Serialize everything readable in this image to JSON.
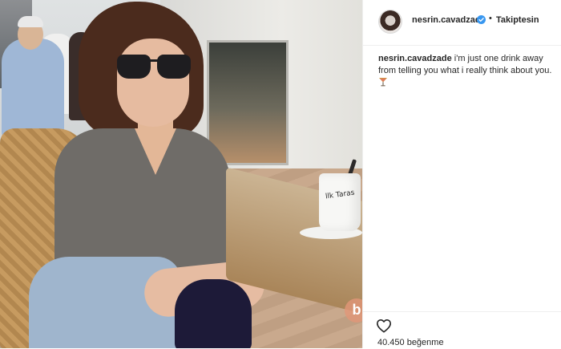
{
  "post": {
    "username": "nesrin.cavadzade",
    "follow_label": "Takiptesin",
    "caption_user": "nesrin.cavadzade",
    "caption_text": " i'm just one drink away from telling you what i really think about you.",
    "cup_text": "llk Taras",
    "watermark_letter": "b",
    "likes": "40.450 beğenme"
  },
  "icons": {
    "verified": "verified-badge-icon",
    "cocktail": "cocktail-glass-icon",
    "heart": "heart-outline-icon",
    "verified_color": "#3897f0"
  }
}
